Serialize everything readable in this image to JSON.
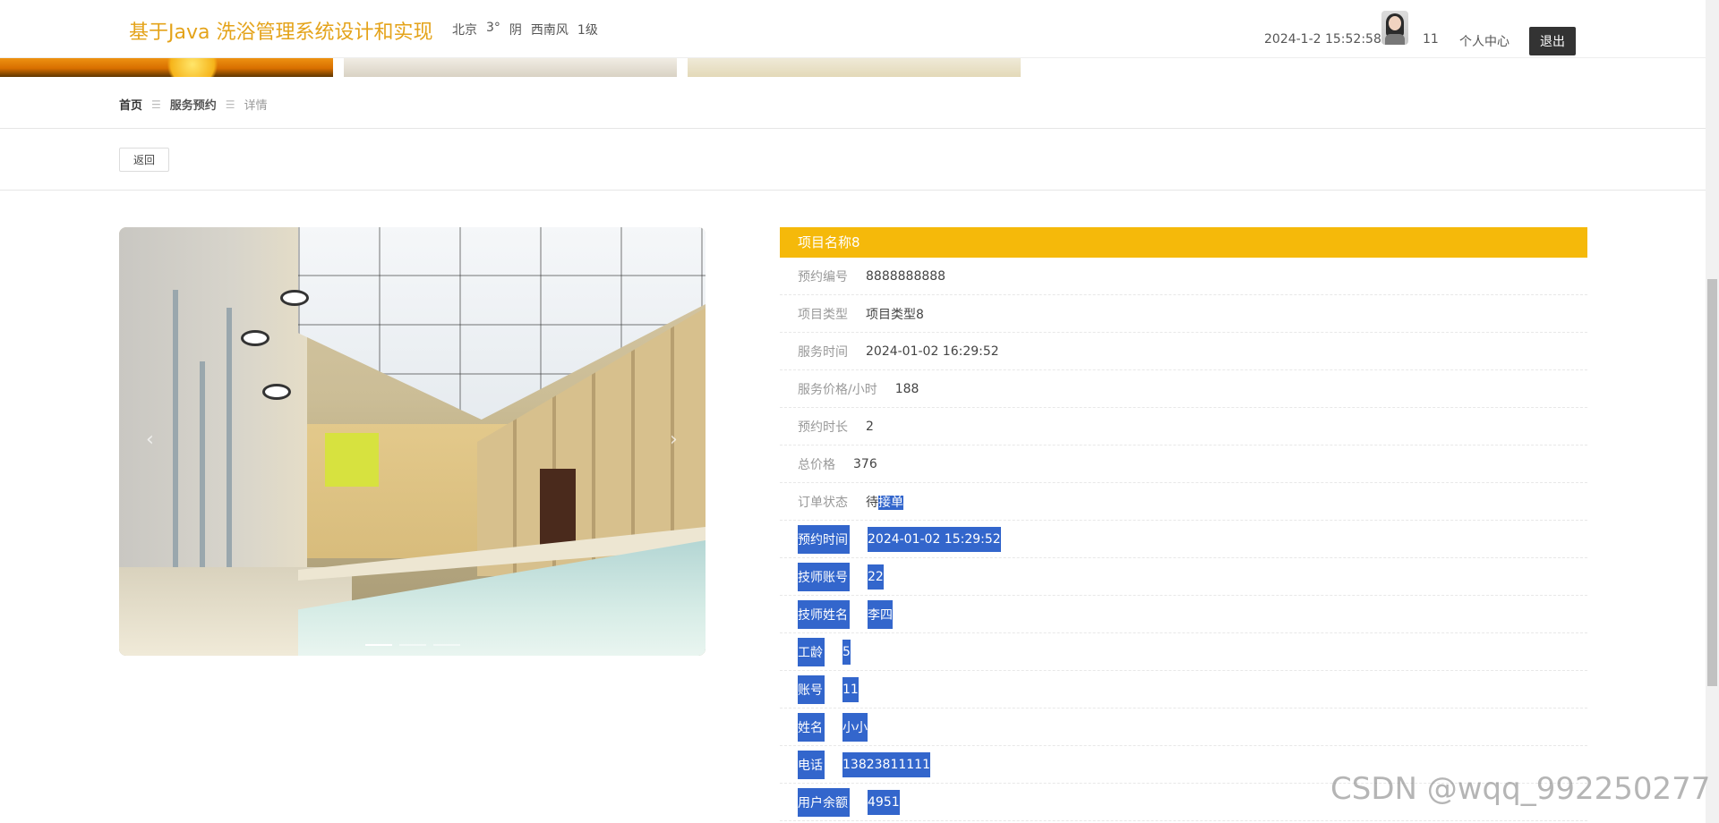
{
  "header": {
    "logo": "基于Java 洗浴管理系统设计和实现",
    "weather": {
      "city": "北京",
      "temp": "3°",
      "condition": "阴",
      "wind": "西南风",
      "level": "1级"
    },
    "datetime": "2024-1-2 15:52:58",
    "username": "11",
    "profile_link": "个人中心",
    "logout": "退出"
  },
  "breadcrumb": {
    "home": "首页",
    "section": "服务预约",
    "current": "详情"
  },
  "back_button": "返回",
  "carousel": {
    "prev": "‹",
    "next": "›",
    "slide_count": 3,
    "active_slide": 1
  },
  "detail": {
    "title": "项目名称8",
    "rows": [
      {
        "label": "预约编号",
        "value": "8888888888"
      },
      {
        "label": "项目类型",
        "value": "项目类型8"
      },
      {
        "label": "服务时间",
        "value": "2024-01-02 16:29:52"
      },
      {
        "label": "服务价格/小时",
        "value": "188"
      },
      {
        "label": "预约时长",
        "value": "2"
      },
      {
        "label": "总价格",
        "value": "376"
      },
      {
        "label": "订单状态",
        "value": "待接单"
      },
      {
        "label": "预约时间",
        "value": "2024-01-02 15:29:52"
      },
      {
        "label": "技师账号",
        "value": "22"
      },
      {
        "label": "技师姓名",
        "value": "李四"
      },
      {
        "label": "工龄",
        "value": "5"
      },
      {
        "label": "账号",
        "value": "11"
      },
      {
        "label": "姓名",
        "value": "小小"
      },
      {
        "label": "电话",
        "value": "13823811111"
      },
      {
        "label": "用户余额",
        "value": "4951"
      }
    ]
  },
  "watermark": "CSDN @wqq_992250277",
  "colors": {
    "brand": "#e4a31a",
    "title_bar": "#f5b90a",
    "selection": "#3366cc",
    "logout_bg": "#333333"
  }
}
